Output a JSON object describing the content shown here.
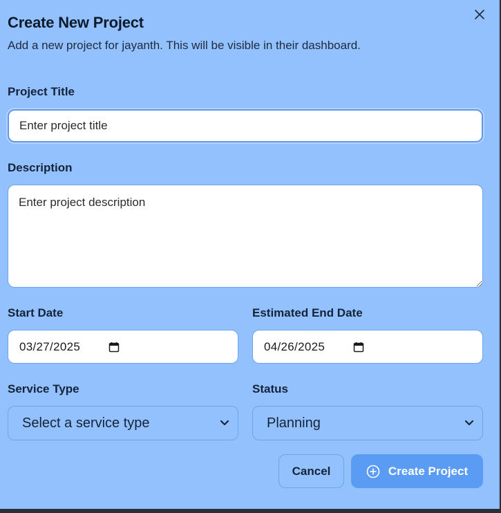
{
  "dialog": {
    "title": "Create New Project",
    "subtitle": "Add a new project for jayanth. This will be visible in their dashboard."
  },
  "form": {
    "project_title": {
      "label": "Project Title",
      "placeholder": "Enter project title",
      "value": ""
    },
    "description": {
      "label": "Description",
      "placeholder": "Enter project description",
      "value": ""
    },
    "start_date": {
      "label": "Start Date",
      "value": "03/27/2025"
    },
    "end_date": {
      "label": "Estimated End Date",
      "value": "04/26/2025"
    },
    "service_type": {
      "label": "Service Type",
      "selected": "Select a service type"
    },
    "status": {
      "label": "Status",
      "selected": "Planning"
    }
  },
  "actions": {
    "cancel_label": "Cancel",
    "create_label": "Create Project"
  },
  "icons": {
    "close": "close-icon",
    "calendar": "calendar-icon",
    "chevron": "chevron-down-icon",
    "plus_circle": "plus-circle-icon"
  },
  "colors": {
    "dialog_bg": "#93c1fd",
    "primary_button": "#5a9cf4",
    "border": "#6aa5f0"
  }
}
